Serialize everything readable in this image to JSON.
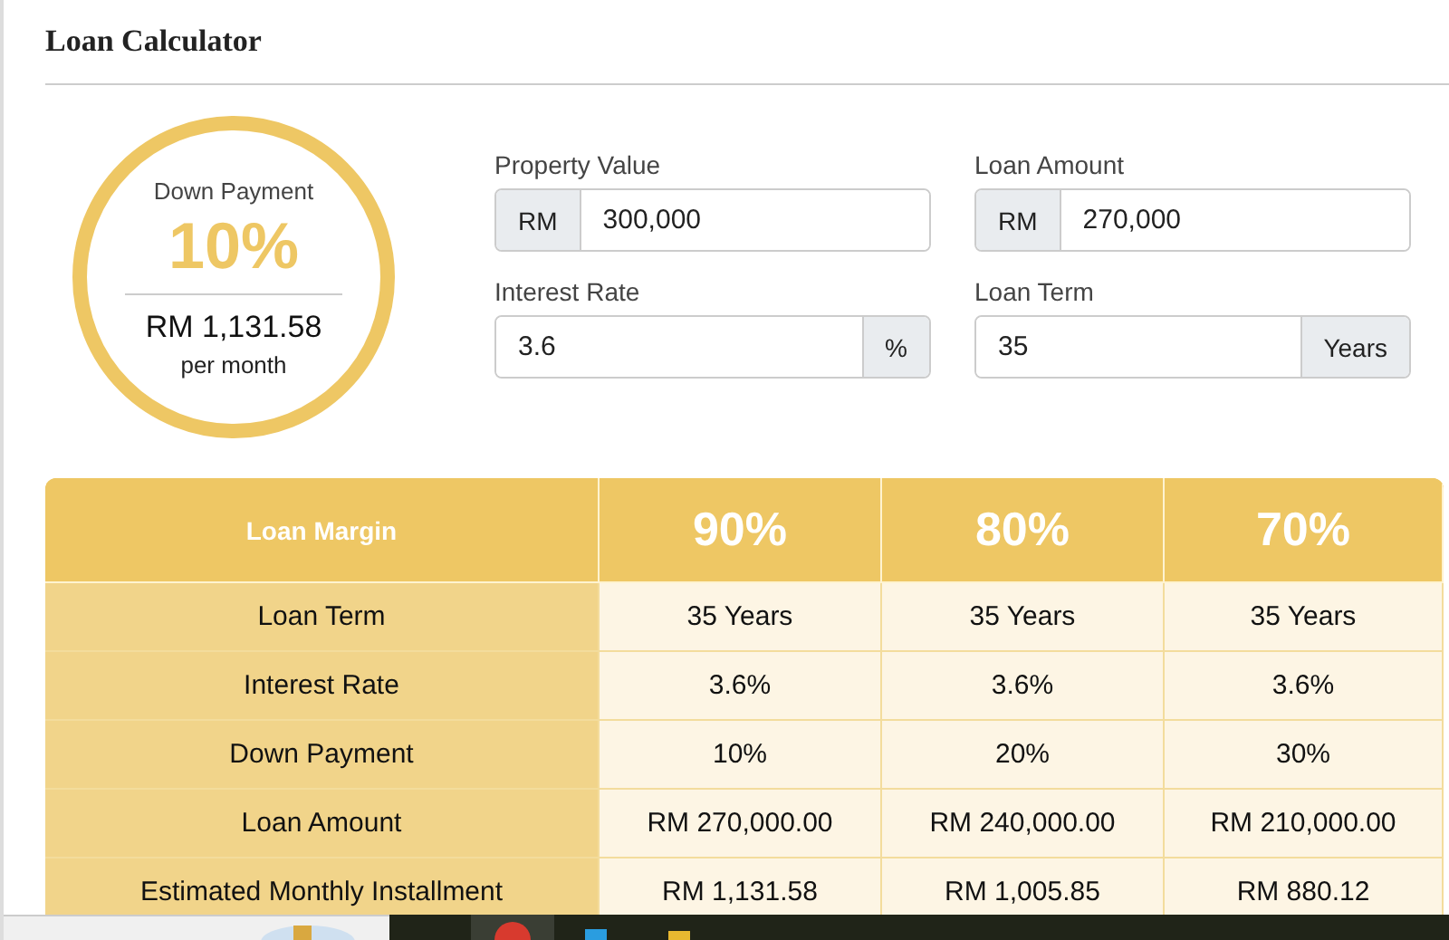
{
  "title": "Loan Calculator",
  "summary": {
    "label": "Down Payment",
    "percent": "10%",
    "amount": "RM 1,131.58",
    "period": "per month"
  },
  "fields": [
    {
      "label": "Property Value",
      "prefix": "RM",
      "value": "300,000"
    },
    {
      "label": "Loan Amount",
      "prefix": "RM",
      "value": "270,000"
    },
    {
      "label": "Interest Rate",
      "value": "3.6",
      "suffix": "%"
    },
    {
      "label": "Loan Term",
      "value": "35",
      "suffix": "Years"
    }
  ],
  "table": {
    "row_header_title": "Loan Margin",
    "columns": [
      "90%",
      "80%",
      "70%"
    ],
    "rows": [
      {
        "label": "Loan Term",
        "cells": [
          "35 Years",
          "35 Years",
          "35 Years"
        ]
      },
      {
        "label": "Interest Rate",
        "cells": [
          "3.6%",
          "3.6%",
          "3.6%"
        ]
      },
      {
        "label": "Down Payment",
        "cells": [
          "10%",
          "20%",
          "30%"
        ]
      },
      {
        "label": "Loan Amount",
        "cells": [
          "RM 270,000.00",
          "RM 240,000.00",
          "RM 210,000.00"
        ]
      },
      {
        "label": "Estimated Monthly Installment",
        "cells": [
          "RM 1,131.58",
          "RM 1,005.85",
          "RM 880.12"
        ]
      }
    ]
  }
}
